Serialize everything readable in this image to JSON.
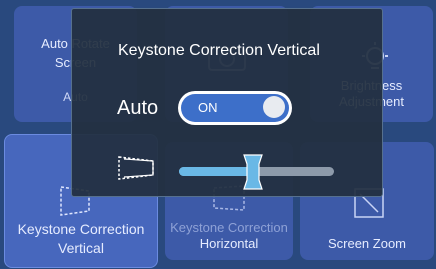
{
  "tiles": {
    "auto_rotate": {
      "title_line1": "Auto Rotate",
      "title_line2": "Screen",
      "sub": "Auto"
    },
    "brightness": {
      "title_line1": "Brightness",
      "title_line2": "Adjustment"
    },
    "keystone_vertical": {
      "title_line1": "Keystone Correction",
      "title_line2": "Vertical"
    },
    "keystone_horizontal": {
      "title_line1": "Keystone Correction",
      "title_line2": "Horizontal"
    },
    "screen_zoom": {
      "title": "Screen Zoom"
    }
  },
  "dialog": {
    "title": "Keystone Correction Vertical",
    "auto_label": "Auto",
    "toggle_state": "ON",
    "slider_value_fraction": 0.48
  },
  "colors": {
    "background": "#29497e",
    "tile": "#3d5aa8",
    "dialog": "#222f40",
    "toggle_on": "#3d6fc9",
    "slider_thumb": "#6ab8e6"
  },
  "icons": [
    "projector-icon",
    "brightness-icon",
    "keystone-vertical-icon",
    "keystone-horizontal-icon",
    "screen-zoom-icon",
    "keystone-trapezoid-icon"
  ]
}
